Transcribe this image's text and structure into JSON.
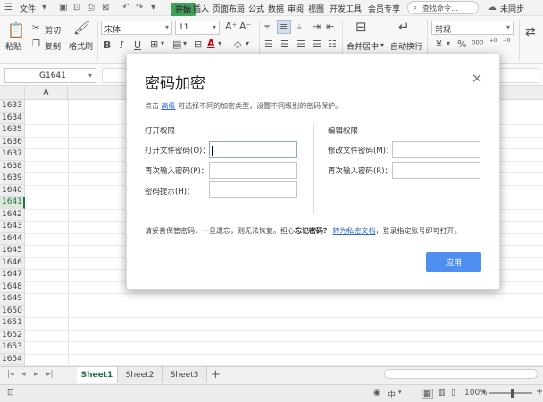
{
  "menubar": {
    "file_label": "文件",
    "tabs": [
      "插入",
      "页面布局",
      "公式",
      "数据",
      "审阅",
      "视图",
      "开发工具",
      "会员专享"
    ],
    "active_tab": "开始",
    "search_placeholder": "查找命令...",
    "sync_status": "未同步"
  },
  "ribbon": {
    "paste": "粘贴",
    "cut": "剪切",
    "copy": "复制",
    "format_painter": "格式刷",
    "font_name": "宋体",
    "font_size": "11",
    "merge_center": "合并居中",
    "wrap_text": "自动换行",
    "number_format": "常规",
    "currency": "¥",
    "percent": "%"
  },
  "formula_bar": {
    "cell_ref": "G1641"
  },
  "grid": {
    "column_header": "A",
    "rows": [
      "1633",
      "1634",
      "1635",
      "1636",
      "1637",
      "1638",
      "1639",
      "1640",
      "1641",
      "1642",
      "1643",
      "1644",
      "1645",
      "1646",
      "1647",
      "1648",
      "1649",
      "1650",
      "1651",
      "1652",
      "1653",
      "1654"
    ],
    "selected_row": "1641"
  },
  "sheets": [
    "Sheet1",
    "Sheet2",
    "Sheet3"
  ],
  "add_sheet": "+",
  "status": {
    "zoom": "100%"
  },
  "dialog": {
    "title": "密码加密",
    "desc_prefix": "点击",
    "desc_link": "高级",
    "desc_suffix": "可选择不同的加密类型，设置不同级别的密码保护。",
    "open_section": "打开权限",
    "open_password_label": "打开文件密码(O)：",
    "open_password_confirm_label": "再次输入密码(P)：",
    "password_hint_label": "密码提示(H)：",
    "edit_section": "编辑权限",
    "edit_password_label": "修改文件密码(M)：",
    "edit_password_confirm_label": "再次输入密码(R)：",
    "note_prefix": "请妥善保管密码，一旦遗忘，则无法恢复。担心",
    "note_bold": "忘记密码？",
    "note_link": "转为私密文档",
    "note_suffix": "，登录指定账号即可打开。",
    "apply_button": "应用"
  }
}
